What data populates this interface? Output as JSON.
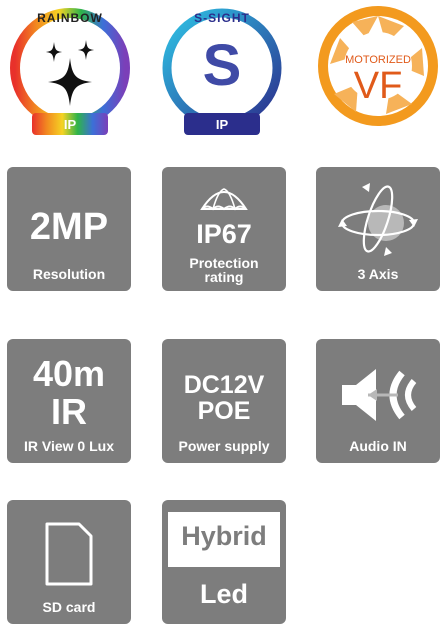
{
  "badges": {
    "rainbow": {
      "arc_text": "RAINBOW",
      "bottom_label": "IP"
    },
    "ssight": {
      "arc_text": "S-SIGHT",
      "letter": "S",
      "bottom_label": "IP"
    },
    "motorized": {
      "top_text": "MOTORIZED",
      "big_text": "VF"
    }
  },
  "features": {
    "resolution": {
      "value": "2MP",
      "caption": "Resolution"
    },
    "protection": {
      "value": "IP67",
      "caption_line1": "Protection",
      "caption_line2": "rating"
    },
    "axis": {
      "caption": "3 Axis"
    },
    "ir": {
      "value_line1": "40m",
      "value_line2": "IR",
      "caption": "IR View 0 Lux"
    },
    "power": {
      "value_line1": "DC12V",
      "value_line2": "POE",
      "caption": "Power supply"
    },
    "audio": {
      "caption": "Audio IN"
    },
    "sdcard": {
      "caption": "SD card"
    },
    "hybrid": {
      "top": "Hybrid",
      "bottom": "Led"
    }
  },
  "colors": {
    "tile_gray": "#7d7d7d",
    "ssight_blue": "#2b2e8c",
    "motorized_orange": "#f39a1e"
  },
  "icons": [
    "sparkle-stars-icon",
    "s-letter-icon",
    "camera-aperture-icon",
    "umbrella-icon",
    "three-axis-rotation-icon",
    "speaker-sound-icon",
    "sd-card-icon"
  ]
}
